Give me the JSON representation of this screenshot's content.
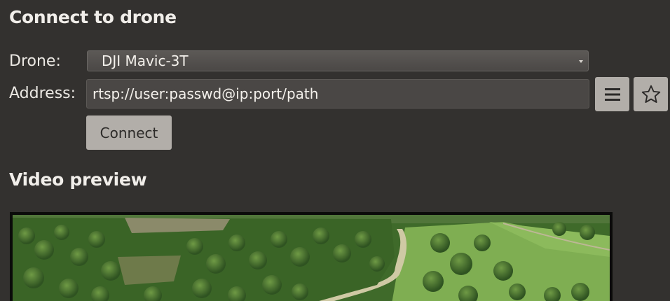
{
  "section_connect": {
    "title": "Connect to drone",
    "drone_label": "Drone:",
    "drone_selected": "DJI Mavic-3T",
    "address_label": "Address:",
    "address_value": "rtsp://user:passwd@ip:port/path",
    "list_button_icon": "hamburger-menu-icon",
    "favorite_button_icon": "star-outline-icon",
    "connect_label": "Connect"
  },
  "section_video": {
    "title": "Video preview",
    "content": "aerial-forest-landscape"
  },
  "colors": {
    "background": "#33312f",
    "button": "#b2aea9",
    "field": "#4a4745",
    "text": "#ece9e4"
  }
}
